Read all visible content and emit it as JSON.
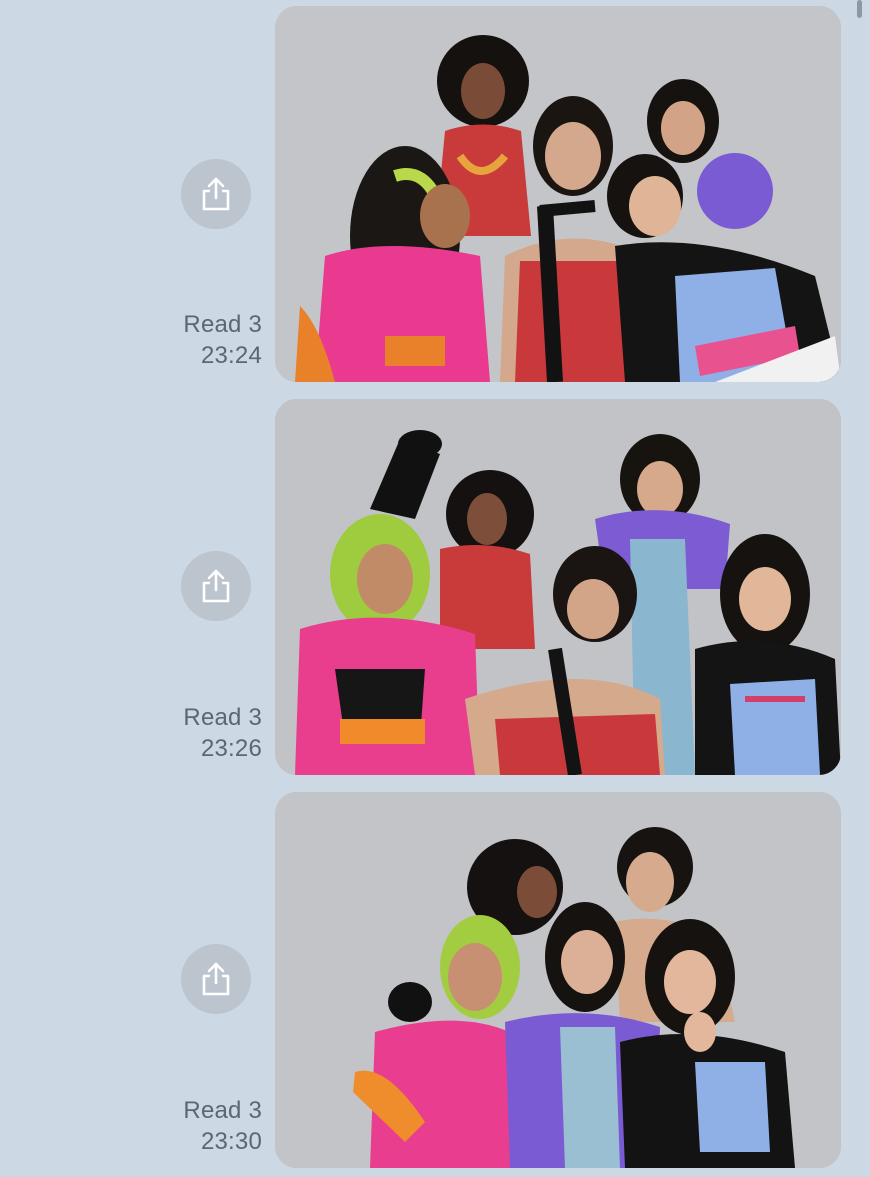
{
  "messages": [
    {
      "read_label": "Read 3",
      "time": "23:24",
      "photo_alt": "Group photo of five women in colorful outfits"
    },
    {
      "read_label": "Read 3",
      "time": "23:26",
      "photo_alt": "Group photo of five women posing with playful expressions"
    },
    {
      "read_label": "Read 3",
      "time": "23:30",
      "photo_alt": "Group photo of five women with surprised expressions"
    }
  ],
  "icons": {
    "share": "share-icon"
  },
  "colors": {
    "background": "#cdd8e5",
    "share_button": "#bcc4ce",
    "meta_text": "#5c6674"
  }
}
